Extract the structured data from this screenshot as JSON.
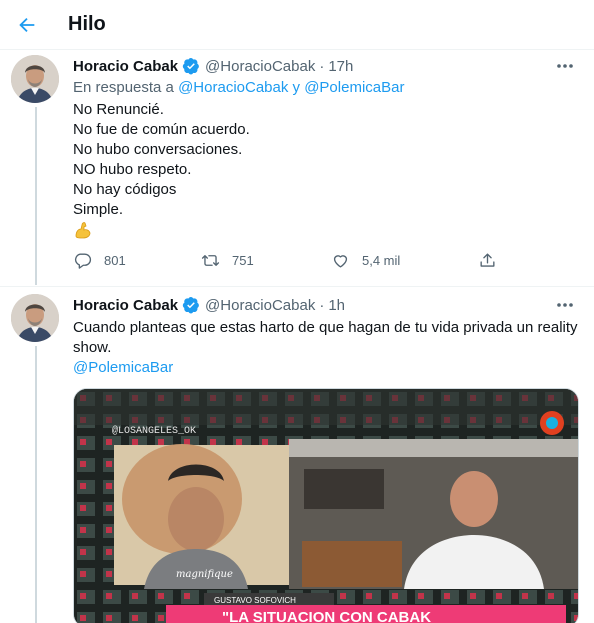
{
  "header": {
    "title": "Hilo",
    "back_icon": "arrow-left-icon"
  },
  "colors": {
    "accent": "#1d9bf0",
    "secondary_text": "#536471",
    "text": "#0f1419"
  },
  "tweets": [
    {
      "name": "Horacio Cabak",
      "handle": "@HoracioCabak",
      "separator": "·",
      "time": "17h",
      "reply_prefix": "En respuesta a",
      "reply_user1": "@HoracioCabak",
      "reply_join": "y",
      "reply_user2": "@PolemicaBar",
      "lines": [
        "No Renuncié.",
        "No fue de común acuerdo.",
        "No hubo conversaciones.",
        "NO hubo respeto.",
        "No hay códigos",
        "Simple."
      ],
      "emoji": "flexed-biceps-emoji",
      "replies": "801",
      "retweets": "751",
      "likes": "5,4 mil"
    },
    {
      "name": "Horacio Cabak",
      "handle": "@HoracioCabak",
      "separator": "·",
      "time": "1h",
      "lines": [
        "Cuando planteas que estas harto  de que hagan de tu vida privada un reality",
        "show."
      ],
      "mention": "@PolemicaBar",
      "media": {
        "watermark": "@LOSANGELES_OK",
        "shirt_text": "magnifique",
        "nameplate": "GUSTAVO SOFOVICH",
        "banner": "\"LA SITUACION CON CABAK"
      }
    }
  ]
}
